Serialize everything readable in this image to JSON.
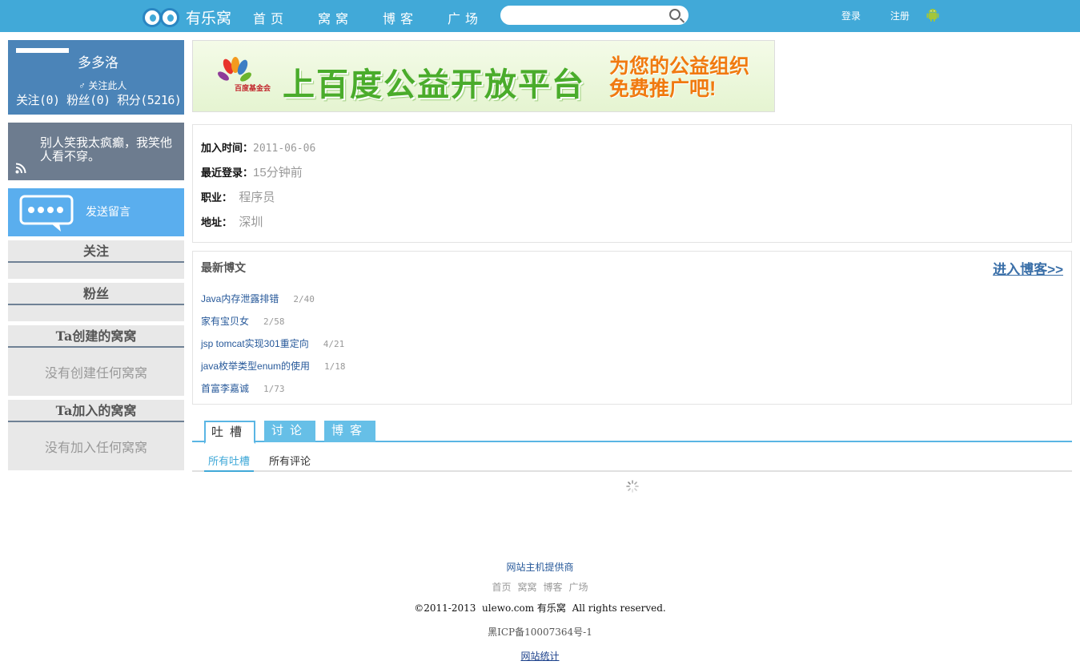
{
  "header": {
    "logo_text": "有乐窝",
    "nav": [
      "首页",
      "窝窝",
      "博客",
      "广场"
    ],
    "search_placeholder": "",
    "login": "登录",
    "register": "注册"
  },
  "profile": {
    "name": "多多洛",
    "follow_label": "♂ 关注此人",
    "stats": "关注(0) 粉丝(0) 积分(5216)"
  },
  "motto": "别人笑我太疯癫，我笑他人看不穿。",
  "message_button": "发送留言",
  "sidebar": {
    "following_title": "关注",
    "fans_title": "粉丝",
    "created_title": "Ta创建的窝窝",
    "created_empty": "没有创建任何窝窝",
    "joined_title": "Ta加入的窝窝",
    "joined_empty": "没有加入任何窝窝"
  },
  "banner": {
    "logo_text": "百度基金会",
    "main": "上百度公益开放平台",
    "side_line1": "为您的公益组织",
    "side_line2": "免费推广吧!"
  },
  "info": {
    "join_label": "加入时间：",
    "join_value": "2011-06-06",
    "last_login_label": "最近登录：",
    "last_login_value": "15分钟前",
    "job_label": "职业：",
    "job_value": "程序员",
    "address_label": "地址：",
    "address_value": "深圳"
  },
  "blog": {
    "title": "最新博文",
    "more": "进入博客>>",
    "items": [
      {
        "title": "Java内存泄露排错",
        "count": "2/40"
      },
      {
        "title": "家有宝贝女",
        "count": "2/58"
      },
      {
        "title": "jsp tomcat实现301重定向",
        "count": "4/21"
      },
      {
        "title": "java枚举类型enum的使用",
        "count": "1/18"
      },
      {
        "title": "首富李嘉诚",
        "count": "1/73"
      }
    ]
  },
  "tabs": [
    "吐槽",
    "讨论",
    "博客"
  ],
  "subtabs": [
    "所有吐槽",
    "所有评论"
  ],
  "footer": {
    "host": "网站主机提供商",
    "links": [
      "首页",
      "窝窝",
      "博客",
      "广场"
    ],
    "copyright": "©2011-2013  ulewo.com 有乐窝  All rights reserved.",
    "icp": "黑ICP备10007364号-1",
    "stats": "网站统计"
  },
  "colors": {
    "topbar": "#41a9d8",
    "profile": "#4b84b8",
    "motto": "#6d7c8f",
    "message": "#5aaeee",
    "tab": "#66bfe7"
  }
}
